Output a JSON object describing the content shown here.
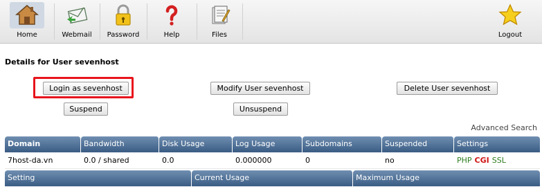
{
  "toolbar": {
    "items": [
      {
        "label": "Home",
        "icon": "home-icon"
      },
      {
        "label": "Webmail",
        "icon": "mail-icon"
      },
      {
        "label": "Password",
        "icon": "lock-icon"
      },
      {
        "label": "Help",
        "icon": "question-icon"
      },
      {
        "label": "Files",
        "icon": "files-icon"
      },
      {
        "label": "Logout",
        "icon": "star-icon"
      }
    ]
  },
  "page": {
    "title": "Details for User sevenhost"
  },
  "actions": {
    "login": "Login as sevenhost",
    "modify": "Modify User sevenhost",
    "delete": "Delete User sevenhost",
    "suspend": "Suspend",
    "unsuspend": "Unsuspend"
  },
  "advanced_search": "Advanced Search",
  "table": {
    "headers": [
      "Domain",
      "Bandwidth",
      "Disk Usage",
      "Log Usage",
      "Subdomains",
      "Suspended",
      "Settings"
    ],
    "row": {
      "domain": "7host-da.vn",
      "bandwidth": "0.0 / shared",
      "disk_usage": "0.0",
      "log_usage": "0.000000",
      "subdomains": "0",
      "suspended": "no",
      "settings": [
        {
          "label": "PHP",
          "color": "#2e7d1f"
        },
        {
          "label": "CGI",
          "color": "#d01515"
        },
        {
          "label": "SSL",
          "color": "#2e7d1f"
        }
      ]
    }
  },
  "usage_table": {
    "headers": [
      "Setting",
      "Current Usage",
      "Maximum Usage"
    ]
  },
  "colors": {
    "header_bg": "#4a6a91",
    "highlight": "#e8141c"
  }
}
